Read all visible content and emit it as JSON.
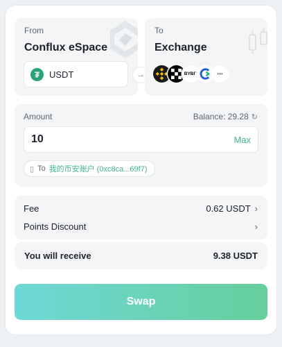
{
  "from": {
    "label": "From",
    "chain": "Conflux eSpace",
    "token": {
      "symbol": "USDT",
      "icon": "tether-icon",
      "color": "#2aa37c"
    }
  },
  "to": {
    "label": "To",
    "chain": "Exchange",
    "exchanges": [
      {
        "name": "binance-icon",
        "color": "#f0b90b"
      },
      {
        "name": "okx-icon",
        "color": "#000000"
      },
      {
        "name": "bybit-icon",
        "text": "BYBIT",
        "color": "#000000"
      },
      {
        "name": "kucoin-icon",
        "color": "#23af91"
      },
      {
        "name": "more-icon",
        "text": "•••"
      }
    ]
  },
  "direction_icon": "arrow-right-icon",
  "amount": {
    "label": "Amount",
    "balance": "Balance: 29.28",
    "value": "10",
    "max_label": "Max",
    "to_word": "To",
    "account": "我的币安账户 (0xc8ca...69f7)"
  },
  "fees": {
    "fee_label": "Fee",
    "fee_value": "0.62 USDT",
    "points_label": "Points Discount"
  },
  "receive": {
    "label": "You will receive",
    "value": "9.38 USDT"
  },
  "swap_button": "Swap",
  "colors": {
    "accent": "#3fb58c",
    "button_gradient_start": "#6ed8d8",
    "button_gradient_end": "#66cf9b"
  }
}
